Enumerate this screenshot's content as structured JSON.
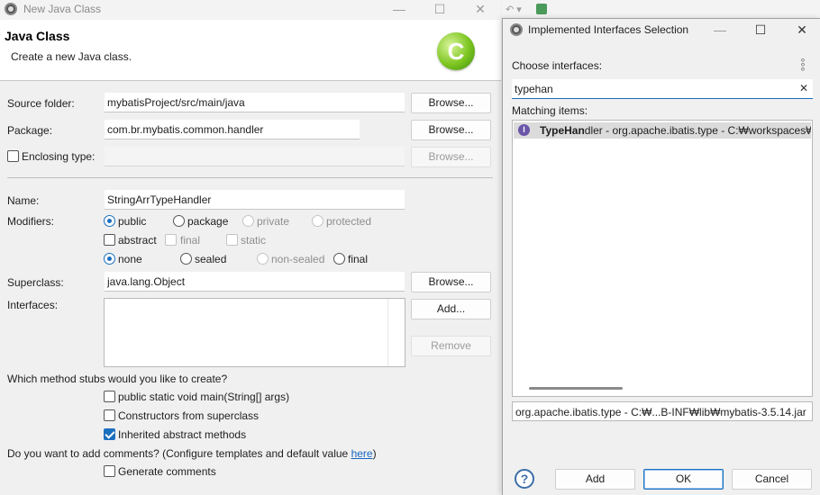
{
  "main": {
    "window_title": "New Java Class",
    "banner_title": "Java Class",
    "banner_subtitle": "Create a new Java class.",
    "source_folder": {
      "label": "Source folder:",
      "value": "mybatisProject/src/main/java",
      "browse": "Browse..."
    },
    "package": {
      "label": "Package:",
      "value": "com.br.mybatis.common.handler",
      "browse": "Browse..."
    },
    "enclosing": {
      "label": "Enclosing type:",
      "value": "",
      "browse": "Browse..."
    },
    "name": {
      "label": "Name:",
      "value": "StringArrTypeHandler"
    },
    "modifiers": {
      "label": "Modifiers:",
      "access": [
        "public",
        "package",
        "private",
        "protected"
      ],
      "access_selected": "public",
      "abstract_label": "abstract",
      "final_label": "final",
      "static_label": "static",
      "sealing": [
        "none",
        "sealed",
        "non-sealed",
        "final"
      ],
      "sealing_selected": "none"
    },
    "superclass": {
      "label": "Superclass:",
      "value": "java.lang.Object",
      "browse": "Browse..."
    },
    "interfaces": {
      "label": "Interfaces:",
      "add": "Add...",
      "remove": "Remove"
    },
    "stubs": {
      "question": "Which method stubs would you like to create?",
      "main_method": "public static void main(String[] args)",
      "constructors": "Constructors from superclass",
      "inherited": "Inherited abstract methods",
      "inherited_checked": true
    },
    "comments": {
      "question_prefix": "Do you want to add comments? (Configure templates and default value ",
      "link": "here",
      "question_suffix": ")",
      "generate": "Generate comments"
    }
  },
  "dialog": {
    "title": "Implemented Interfaces Selection",
    "choose_label": "Choose interfaces:",
    "search_value": "typehan",
    "matching_label": "Matching items:",
    "items": [
      {
        "match": "TypeHan",
        "rest": "dler - org.apache.ibatis.type - C:₩workspaces₩"
      }
    ],
    "status": "org.apache.ibatis.type - C:₩...B-INF₩lib₩mybatis-3.5.14.jar",
    "buttons": {
      "add": "Add",
      "ok": "OK",
      "cancel": "Cancel"
    }
  }
}
